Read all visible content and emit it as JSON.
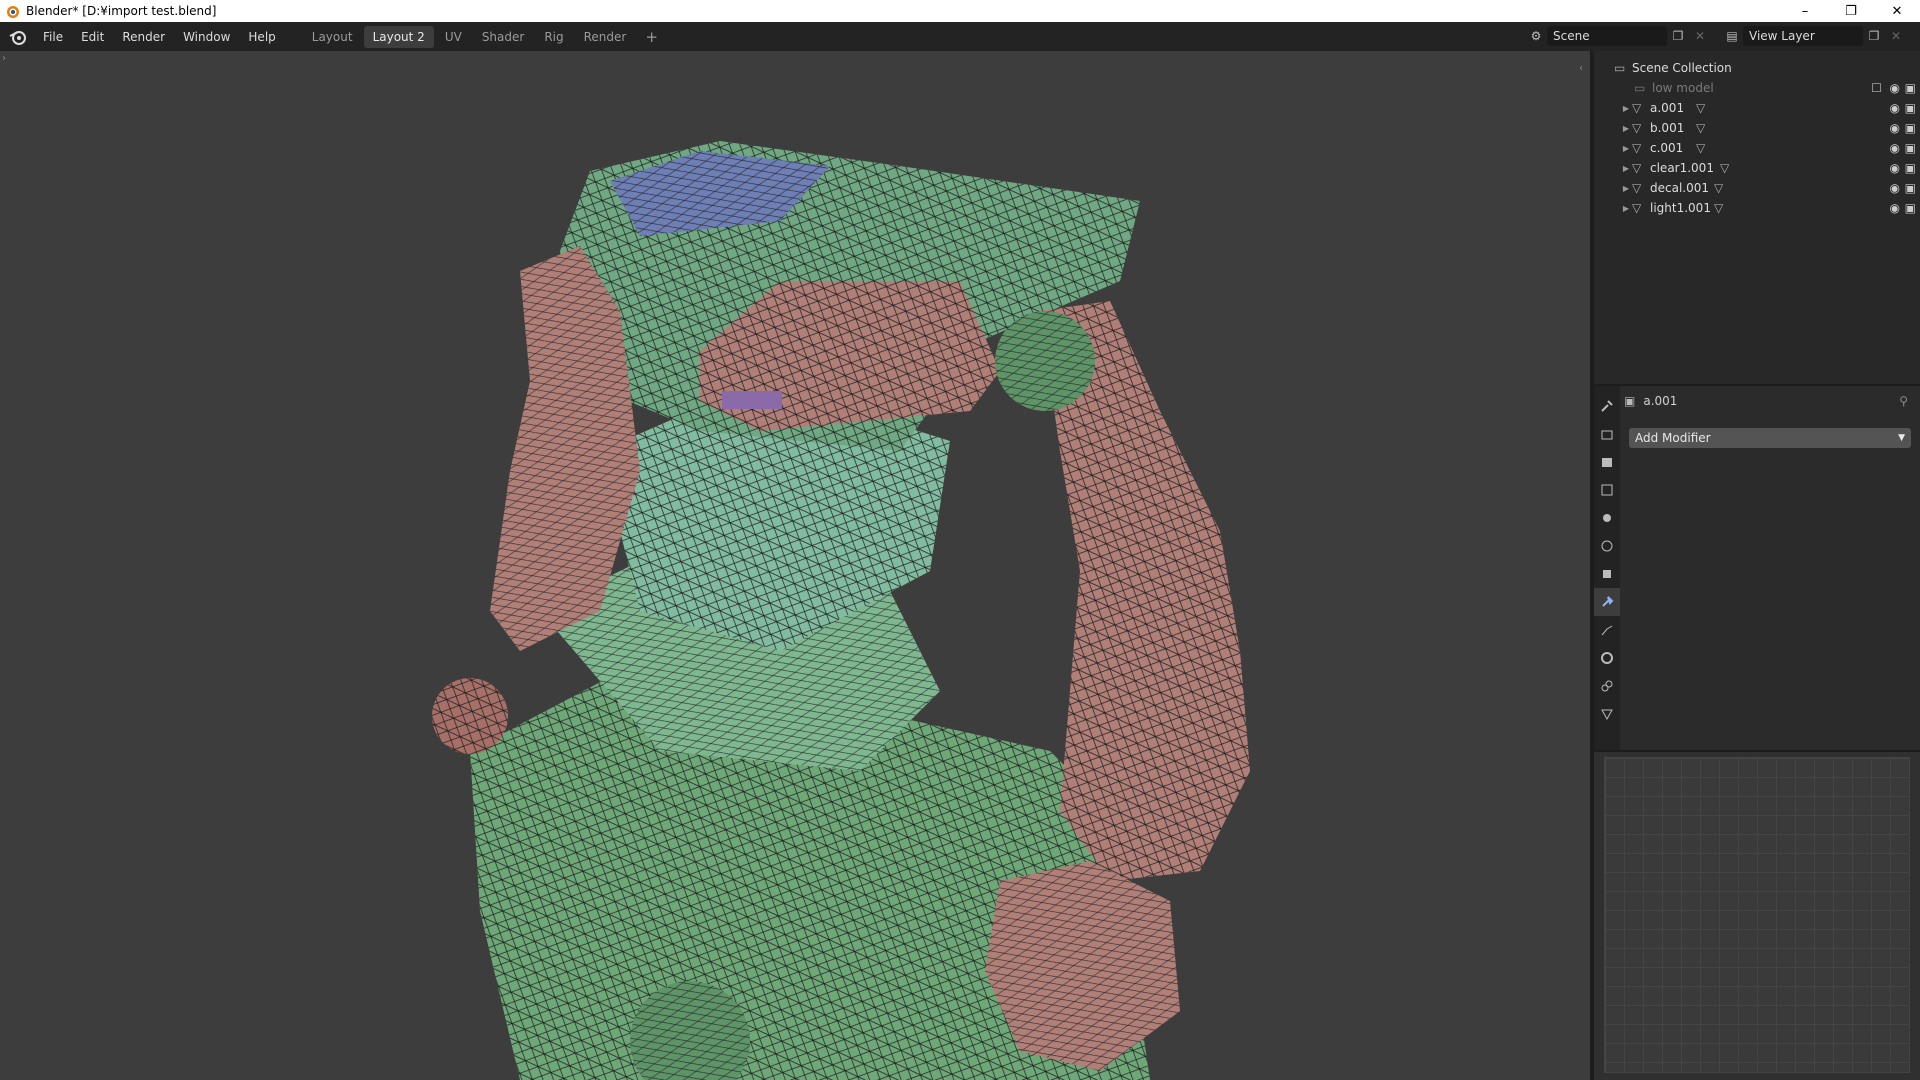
{
  "window": {
    "title": "Blender* [D:¥import test.blend]",
    "controls": [
      "minimize",
      "restore",
      "close"
    ]
  },
  "menubar": {
    "items": [
      "File",
      "Edit",
      "Render",
      "Window",
      "Help"
    ]
  },
  "workspaces": {
    "tabs": [
      "Layout",
      "Layout 2",
      "UV",
      "Shader",
      "Rig",
      "Render"
    ],
    "active": "Layout 2",
    "add_label": "+"
  },
  "scene": {
    "name": "Scene",
    "view_layer": "View Layer"
  },
  "outliner": {
    "root": "Scene Collection",
    "items": [
      {
        "name": "low model",
        "type": "collection",
        "dimmed": true
      },
      {
        "name": "a.001",
        "type": "mesh"
      },
      {
        "name": "b.001",
        "type": "mesh"
      },
      {
        "name": "c.001",
        "type": "mesh"
      },
      {
        "name": "clear1.001",
        "type": "mesh"
      },
      {
        "name": "decal.001",
        "type": "mesh"
      },
      {
        "name": "light1.001",
        "type": "mesh"
      }
    ]
  },
  "properties": {
    "object_name": "a.001",
    "add_modifier_label": "Add Modifier",
    "tabs": [
      "tool-icon",
      "render-icon",
      "output-icon",
      "view-layer-icon",
      "scene-icon",
      "world-icon",
      "object-icon",
      "modifier-icon",
      "particles-icon",
      "physics-icon",
      "constraints-icon",
      "data-icon"
    ],
    "active_tab": "modifier-icon"
  },
  "colors": {
    "accent": "#4772b3",
    "viewport_bg": "#3d3d3d",
    "green_mesh": "#6fa878",
    "pink_mesh": "#b07f78",
    "blue_mesh": "#6e7fb5"
  }
}
